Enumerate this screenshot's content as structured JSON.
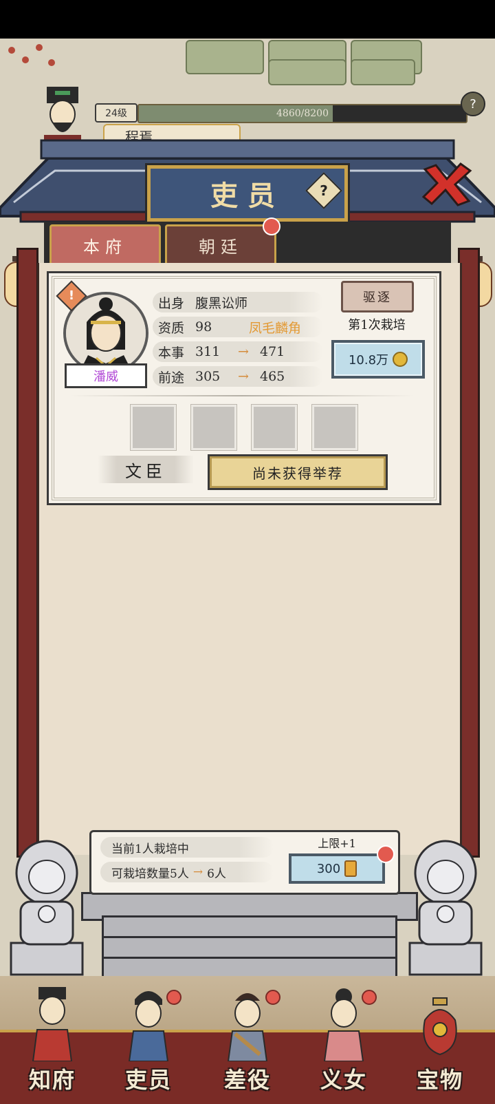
{
  "player": {
    "level": "24级",
    "exp_text": "4860/8200",
    "exp_progress": 0.593,
    "name": "程焉"
  },
  "window": {
    "title": "吏员",
    "tabs": [
      {
        "label": "本府",
        "active": true
      },
      {
        "label": "朝廷",
        "active": false
      }
    ]
  },
  "officer": {
    "name": "潘威",
    "origin_label": "出身",
    "origin_value": "腹黑讼师",
    "aptitude_label": "资质",
    "aptitude_value": "98",
    "aptitude_tag": "凤毛麟角",
    "skill_label": "本事",
    "skill_value": "311",
    "skill_next": "471",
    "prospect_label": "前途",
    "prospect_value": "305",
    "prospect_next": "465",
    "arrow": "→",
    "type": "文臣",
    "recommend_label": "尚未获得举荐",
    "expel_label": "驱逐",
    "train_count": "第1次栽培",
    "train_cost": "10.8万"
  },
  "training": {
    "current": "当前1人栽培中",
    "capacity": "可栽培数量5人",
    "capacity_next": "6人",
    "limit_label": "上限+1",
    "limit_cost": "300"
  },
  "nav": [
    {
      "label": "知府",
      "dot": false
    },
    {
      "label": "吏员",
      "dot": true
    },
    {
      "label": "差役",
      "dot": true
    },
    {
      "label": "义女",
      "dot": true
    },
    {
      "label": "宝物",
      "dot": false
    }
  ],
  "colors": {
    "accent_gold": "#c9a24a",
    "plaque_blue": "#3e557a",
    "pillar_red": "#7a2e2a",
    "notify_red": "#e25a4f",
    "rarity_orange": "#e39a35",
    "name_purple": "#b24ad6"
  }
}
